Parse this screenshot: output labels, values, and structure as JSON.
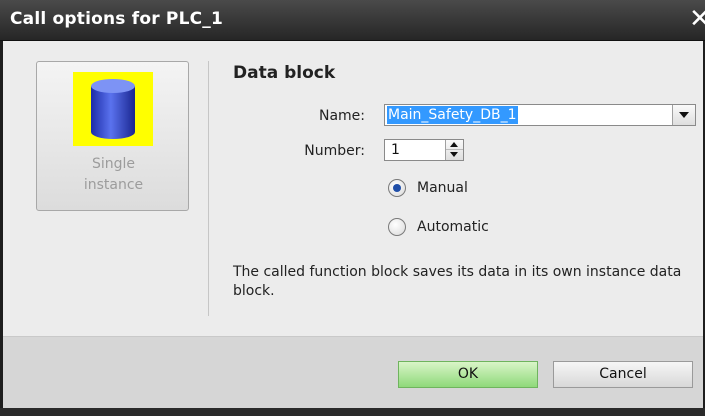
{
  "window": {
    "title": "Call options for PLC_1",
    "close_glyph": "✕"
  },
  "instance_card": {
    "icon": "database-cylinder-icon",
    "label_line1": "Single",
    "label_line2": "instance"
  },
  "data_block": {
    "heading": "Data block",
    "name_label": "Name:",
    "name_value": "Main_Safety_DB_1",
    "number_label": "Number:",
    "number_value": "1",
    "radio_options": [
      {
        "label": "Manual",
        "selected": true
      },
      {
        "label": "Automatic",
        "selected": false
      }
    ]
  },
  "description": "The called function block saves its data in its own instance data block.",
  "buttons": {
    "ok": "OK",
    "cancel": "Cancel"
  },
  "colors": {
    "ok_accent": "#8fd97a",
    "icon_background": "#ffff00",
    "selection": "#3399ff"
  }
}
